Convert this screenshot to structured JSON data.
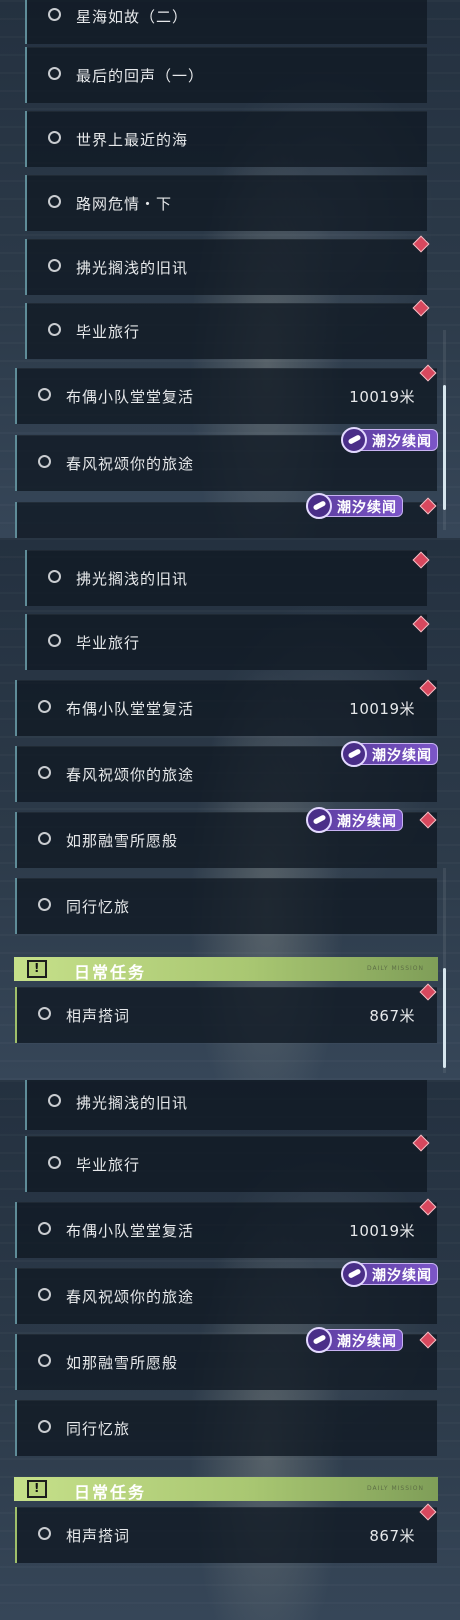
{
  "tag_label": "潮汐续闻",
  "section_title": "日常任务",
  "section_subtitle": "DAILY MISSION",
  "panel1": {
    "quests": [
      "星海如故（二）",
      "最后的回声（一）",
      "世界上最近的海",
      "路网危情・下",
      "拂光搁浅的旧讯",
      "毕业旅行",
      "布偶小队堂堂复活",
      "春风祝颂你的旅途"
    ],
    "distance": "10019米"
  },
  "panel2": {
    "quests": [
      "拂光搁浅的旧讯",
      "毕业旅行",
      "布偶小队堂堂复活",
      "春风祝颂你的旅途",
      "如那融雪所愿般",
      "同行忆旅"
    ],
    "distance": "10019米",
    "daily_quest": "相声搭词",
    "daily_distance": "867米"
  },
  "panel3": {
    "quests": [
      "拂光搁浅的旧讯",
      "毕业旅行",
      "布偶小队堂堂复活",
      "春风祝颂你的旅途",
      "如那融雪所愿般",
      "同行忆旅"
    ],
    "distance": "10019米",
    "daily_quest": "相声搭词",
    "daily_distance": "867米"
  }
}
